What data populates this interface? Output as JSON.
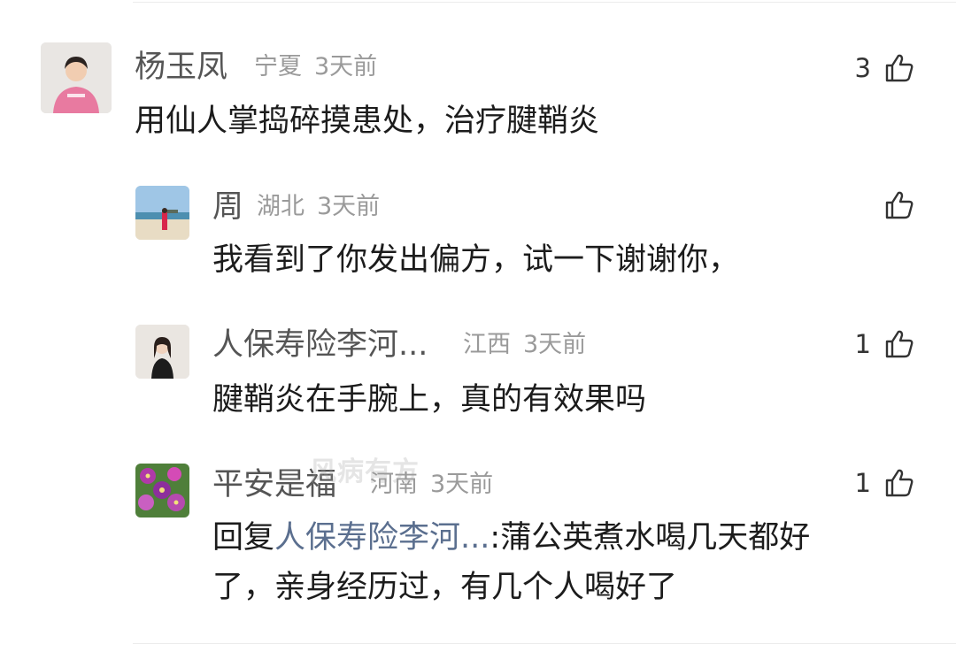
{
  "watermark": "风病有方",
  "comments": [
    {
      "name": "杨玉凤",
      "location": "宁夏",
      "time": "3天前",
      "likes": "3",
      "text": "用仙人掌捣碎摸患处，治疗腱鞘炎",
      "avatar": "girl-pink-sweater-avatar"
    },
    {
      "name": "周",
      "location": "湖北",
      "time": "3天前",
      "likes": "",
      "text": "我看到了你发出偏方，试一下谢谢你，",
      "avatar": "beach-photo-avatar"
    },
    {
      "name": "人保寿险李河...",
      "location": "江西",
      "time": "3天前",
      "likes": "1",
      "text": "腱鞘炎在手腕上，真的有效果吗",
      "avatar": "woman-portrait-avatar"
    },
    {
      "name": "平安是福",
      "location": "河南",
      "time": "3天前",
      "likes": "1",
      "reply_prefix": "回复",
      "reply_target": "人保寿险李河...",
      "reply_line1_rest": ":蒲公英煮水喝几天都好",
      "reply_line2": "了，亲身经历过，有几个人喝好了",
      "avatar": "purple-flowers-avatar"
    }
  ],
  "colors": {
    "name": "#555555",
    "meta": "#9a9a9a",
    "text": "#1c1c1c",
    "reply_target": "#5b6f8f"
  }
}
